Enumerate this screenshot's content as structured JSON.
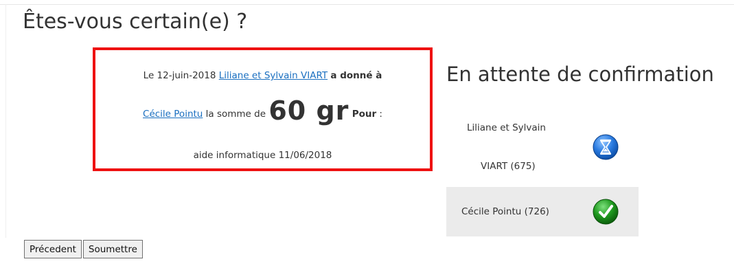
{
  "title": "Êtes-vous certain(e) ?",
  "transaction": {
    "prefix": "Le 12-juin-2018",
    "giver": "Liliane et Sylvain VIART",
    "verb": "a donné à",
    "receiver": "Cécile Pointu",
    "amount_prefix": "la somme de",
    "amount": "60 gr",
    "pour": "Pour",
    "pour_suffix": ":",
    "description": "aide informatique 11/06/2018"
  },
  "status": {
    "heading": "En attente de confirmation",
    "parties": [
      {
        "name_line1": "Liliane et Sylvain",
        "name_line2": "VIART (675)",
        "state": "pending",
        "icon": "hourglass-icon"
      },
      {
        "name": "Cécile Pointu (726)",
        "state": "confirmed",
        "icon": "check-icon"
      }
    ]
  },
  "buttons": {
    "previous": "Précedent",
    "submit": "Soumettre"
  },
  "colors": {
    "highlight_border": "#ee1111",
    "link": "#1a6fc0",
    "pending_icon": "#1e6ccf",
    "confirmed_icon": "#1a8a1a"
  }
}
